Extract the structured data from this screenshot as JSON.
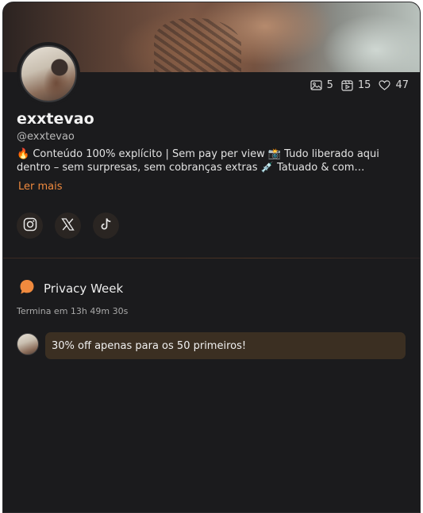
{
  "profile": {
    "name": "exxtevao",
    "handle": "@exxtevao",
    "bio": "🔥 Conteúdo 100% explícito | Sem pay per view 📸 Tudo liberado aqui dentro – sem surpresas, sem cobranças extras 💉 Tatuado & com…",
    "read_more_label": "Ler mais"
  },
  "stats": {
    "photos_icon": "image-icon",
    "photos": "5",
    "videos_icon": "video-icon",
    "videos": "15",
    "likes_icon": "heart-icon",
    "likes": "47"
  },
  "socials": [
    {
      "name": "instagram",
      "icon": "instagram-icon"
    },
    {
      "name": "x",
      "icon": "x-icon"
    },
    {
      "name": "tiktok",
      "icon": "tiktok-icon"
    }
  ],
  "promo": {
    "title": "Privacy Week",
    "countdown": "Termina em 13h 49m 30s",
    "message": "30% off apenas para os 50 primeiros!"
  },
  "colors": {
    "accent": "#f08a3e",
    "background": "#1b1b1d",
    "bubble": "#3b2f22",
    "social_bg": "#2a2522"
  }
}
